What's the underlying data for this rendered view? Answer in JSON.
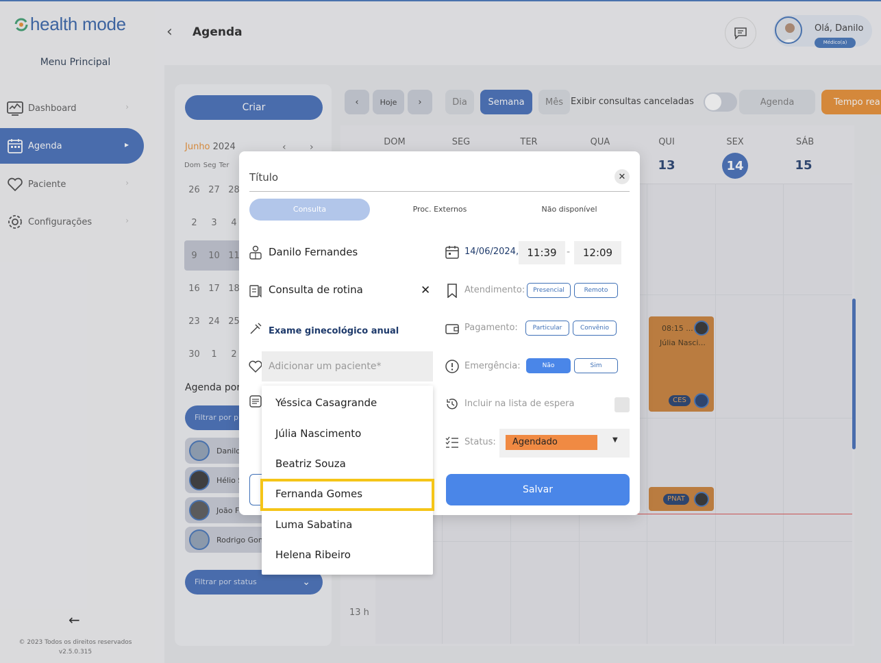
{
  "app": {
    "logo_text": "health mode",
    "menu_title": "Menu Principal"
  },
  "sidebar": {
    "items": [
      {
        "label": "Dashboard",
        "icon": "dashboard-icon"
      },
      {
        "label": "Agenda",
        "icon": "calendar-icon",
        "active": true
      },
      {
        "label": "Paciente",
        "icon": "heart-icon"
      },
      {
        "label": "Configurações",
        "icon": "gear-icon"
      }
    ],
    "copyright": "© 2023 Todos os direitos reservados",
    "version": "v2.5.0.315"
  },
  "header": {
    "title": "Agenda",
    "greeting": "Olá, Danilo",
    "role": "Médico(a)"
  },
  "leftpanel": {
    "create_label": "Criar",
    "month": "Junho",
    "year": "2024",
    "week_header": "Dom Seg Ter",
    "mini_rows": [
      [
        "26",
        "27",
        "28"
      ],
      [
        "2",
        "3",
        "4"
      ],
      [
        "9",
        "10",
        "11"
      ],
      [
        "16",
        "17",
        "18"
      ],
      [
        "23",
        "24",
        "25"
      ],
      [
        "30",
        "1",
        "2"
      ]
    ],
    "agenda_por": "Agenda por",
    "filter_prof": "Filtrar por pr",
    "professionals": [
      "Danilo",
      "Hélio S",
      "João F",
      "Rodrigo Gon"
    ],
    "filter_status": "Filtrar por status"
  },
  "toolbar": {
    "today": "Hoje",
    "day": "Dia",
    "week": "Semana",
    "month": "Mês",
    "show_cancelled": "Exibir consultas canceladas",
    "agenda": "Agenda",
    "tempo_real": "Tempo rea"
  },
  "calendar": {
    "days": [
      {
        "name": "DOM",
        "num": ""
      },
      {
        "name": "SEG",
        "num": ""
      },
      {
        "name": "TER",
        "num": ""
      },
      {
        "name": "QUA",
        "num": ""
      },
      {
        "name": "QUI",
        "num": "13"
      },
      {
        "name": "SEX",
        "num": "14"
      },
      {
        "name": "SÁB",
        "num": "15"
      }
    ],
    "hour_label": "13 h",
    "event1": {
      "time": "08:15 ...",
      "name": "Júlia Nasci...",
      "badge": "CES"
    },
    "event2": {
      "badge": "PNAT"
    }
  },
  "modal": {
    "title_placeholder": "Título",
    "tabs": [
      "Consulta",
      "Proc. Externos",
      "Não disponível"
    ],
    "professional": "Danilo Fernandes",
    "procedure": "Consulta de rotina",
    "exam": "Exame ginecológico anual",
    "patient_placeholder": "Adicionar um paciente*",
    "patients": [
      "Yéssica Casagrande",
      "Júlia Nascimento",
      "Beatriz Souza",
      "Fernanda Gomes",
      "Luma Sabatina",
      "Helena Ribeiro"
    ],
    "date": "14/06/2024",
    "date_sep": ",",
    "start_time": "11:39",
    "end_time": "12:09",
    "atendimento_label": "Atendimento:",
    "atendimento_opts": [
      "Presencial",
      "Remoto"
    ],
    "pagamento_label": "Pagamento:",
    "pagamento_opts": [
      "Particular",
      "Convênio"
    ],
    "emergencia_label": "Emergência:",
    "emergencia_opts": [
      "Não",
      "Sim"
    ],
    "espera_label": "Incluir na lista de espera",
    "status_label": "Status:",
    "status_value": "Agendado",
    "save_label": "Salvar"
  },
  "colors": {
    "primary": "#3f6ab6",
    "accent": "#e88c2d",
    "highlight": "#f5c518",
    "save": "#4a86e8"
  }
}
